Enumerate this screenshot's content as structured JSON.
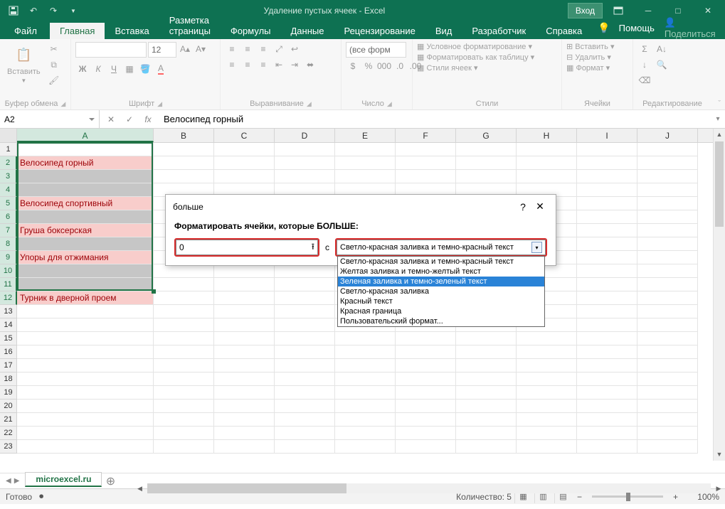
{
  "titlebar": {
    "title": "Удаление пустых ячеек  -  Excel",
    "signin": "Вход"
  },
  "tabs": {
    "file": "Файл",
    "home": "Главная",
    "insert": "Вставка",
    "layout": "Разметка страницы",
    "formulas": "Формулы",
    "data": "Данные",
    "review": "Рецензирование",
    "view": "Вид",
    "developer": "Разработчик",
    "help": "Справка",
    "tell": "Помощь",
    "share": "Поделиться"
  },
  "ribbon": {
    "paste": "Вставить",
    "clipboard": "Буфер обмена",
    "font_label": "Шрифт",
    "alignment": "Выравнивание",
    "number": "Число",
    "number_format": "(все форм",
    "styles": "Стили",
    "cond_format": "Условное форматирование",
    "format_table": "Форматировать как таблицу",
    "cell_styles": "Стили ячеек",
    "cells": "Ячейки",
    "insert_cells": "Вставить",
    "delete_cells": "Удалить",
    "format_cells": "Формат",
    "editing": "Редактирование"
  },
  "formula_bar": {
    "name_box": "A2",
    "value": "Велосипед горный"
  },
  "columns": [
    "A",
    "B",
    "C",
    "D",
    "E",
    "F",
    "G",
    "H",
    "I",
    "J"
  ],
  "row_numbers": [
    1,
    2,
    3,
    4,
    5,
    6,
    7,
    8,
    9,
    10,
    11,
    12,
    13,
    14,
    15,
    16,
    17,
    18,
    19,
    20,
    21,
    22,
    23
  ],
  "data_cells": {
    "2": "Велосипед горный",
    "5": "Велосипед спортивный",
    "7": "Груша боксерская",
    "9": "Упоры для отжимания",
    "12": "Турник в дверной проем"
  },
  "selection_rows": [
    2,
    3,
    4,
    5,
    6,
    7,
    8,
    9,
    10,
    11,
    12
  ],
  "dialog": {
    "title": "больше",
    "prompt": "Форматировать ячейки, которые БОЛЬШЕ:",
    "input_value": "0",
    "with_label": "с",
    "selected": "Светло-красная заливка и темно-красный текст",
    "options": [
      "Светло-красная заливка и темно-красный текст",
      "Желтая заливка и темно-желтый текст",
      "Зеленая заливка и темно-зеленый текст",
      "Светло-красная заливка",
      "Красный текст",
      "Красная граница",
      "Пользовательский формат..."
    ],
    "highlighted_index": 2
  },
  "sheet": {
    "name": "microexcel.ru"
  },
  "statusbar": {
    "ready": "Готово",
    "count_label": "Количество: 5",
    "zoom": "100%"
  }
}
